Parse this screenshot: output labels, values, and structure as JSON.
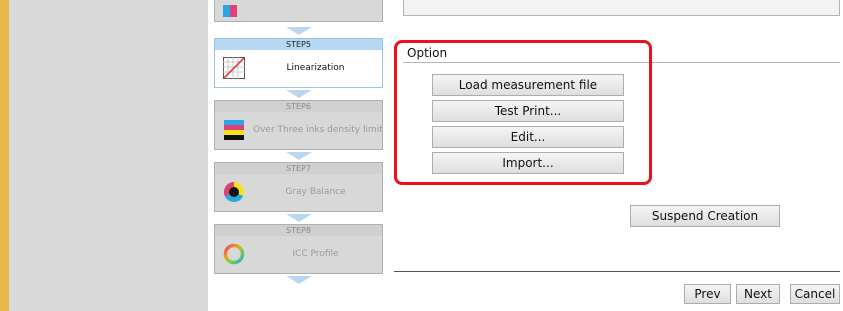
{
  "steps": [
    {
      "label_step": "STEP5",
      "name": "Linearization",
      "active": true
    },
    {
      "label_step": "STEP6",
      "name": "Over Three inks density limit",
      "active": false
    },
    {
      "label_step": "STEP7",
      "name": "Gray Balance",
      "active": false
    },
    {
      "label_step": "STEP8",
      "name": "ICC Profile",
      "active": false
    }
  ],
  "option": {
    "title": "Option",
    "load_label": "Load measurement file",
    "test_print_label": "Test Print...",
    "edit_label": "Edit...",
    "import_label": "Import..."
  },
  "suspend_label": "Suspend Creation",
  "footer": {
    "prev": "Prev",
    "next": "Next",
    "cancel": "Cancel"
  },
  "colors": {
    "accent_left": "#e8b84a",
    "highlight": "#e8121c",
    "active_step_header": "#b7d8f2"
  }
}
